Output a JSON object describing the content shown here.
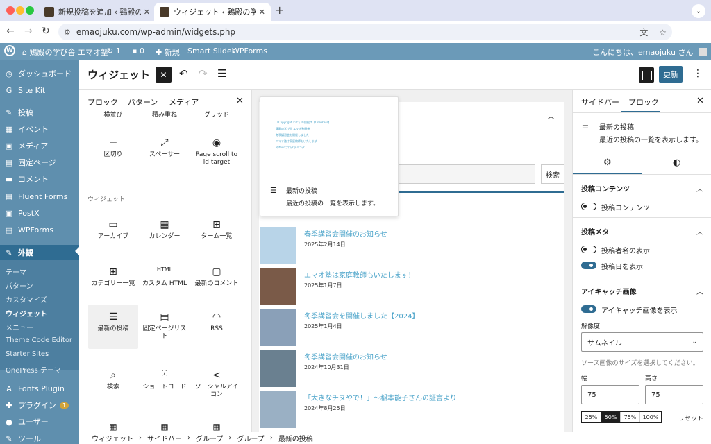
{
  "browser": {
    "tabs": [
      {
        "label": "新規投稿を追加 ‹ 鶏殿の学び舎 エ"
      },
      {
        "label": "ウィジェット ‹ 鶏殿の学び舎 エマ"
      }
    ],
    "url": "emaojuku.com/wp-admin/widgets.php"
  },
  "adminbar": {
    "site_name": "鶏殿の学び舎 エマオ塾",
    "updates_count": "1",
    "comments_count": "0",
    "new_label": "新規",
    "smart_slider": "Smart Slider",
    "wpforms": "WPForms",
    "greeting": "こんにちは、emaojuku さん"
  },
  "sidebar": {
    "items": [
      {
        "icon": "dashboard-icon",
        "glyph": "◷",
        "label": "ダッシュボード"
      },
      {
        "icon": "sitekit-icon",
        "glyph": "G",
        "label": "Site Kit"
      },
      {
        "icon": "pin-icon",
        "glyph": "✎",
        "label": "投稿"
      },
      {
        "icon": "calendar-icon",
        "glyph": "▦",
        "label": "イベント"
      },
      {
        "icon": "media-icon",
        "glyph": "▣",
        "label": "メディア"
      },
      {
        "icon": "page-icon",
        "glyph": "▤",
        "label": "固定ページ"
      },
      {
        "icon": "comment-icon",
        "glyph": "▬",
        "label": "コメント"
      },
      {
        "icon": "forms-icon",
        "glyph": "▤",
        "label": "Fluent Forms"
      },
      {
        "icon": "postx-icon",
        "glyph": "▣",
        "label": "PostX"
      },
      {
        "icon": "wpforms-icon",
        "glyph": "▤",
        "label": "WPForms"
      },
      {
        "icon": "appearance-icon",
        "glyph": "✎",
        "label": "外観"
      }
    ],
    "submenu": [
      "テーマ",
      "パターン",
      "カスタマイズ",
      "ウィジェット",
      "メニュー",
      "Theme Code Editor",
      "Starter Sites",
      "OnePress テーマ"
    ],
    "items_after": [
      {
        "icon": "fonts-icon",
        "glyph": "A",
        "label": "Fonts Plugin"
      },
      {
        "icon": "plugin-icon",
        "glyph": "✚",
        "label": "プラグイン",
        "badge": "1"
      },
      {
        "icon": "user-icon",
        "glyph": "●",
        "label": "ユーザー"
      },
      {
        "icon": "tools-icon",
        "glyph": "✎",
        "label": "ツール"
      }
    ]
  },
  "editor": {
    "title": "ウィジェット",
    "save_label": "更新"
  },
  "inserter": {
    "tabs": [
      "ブロック",
      "パターン",
      "メディア"
    ],
    "partial_labels": [
      "横並び",
      "積み重ね",
      "グリッド"
    ],
    "design_blocks": [
      {
        "icon": "separator-icon",
        "glyph": "⊢",
        "label": "区切り"
      },
      {
        "icon": "spacer-icon",
        "glyph": "⤢",
        "label": "スペーサー"
      },
      {
        "icon": "page-scroll-icon",
        "glyph": "◉",
        "label": "Page scroll to id target"
      }
    ],
    "widgets_label": "ウィジェット",
    "widget_blocks": [
      {
        "icon": "archive-icon",
        "glyph": "▭",
        "label": "アーカイブ"
      },
      {
        "icon": "calendar-icon",
        "glyph": "▦",
        "label": "カレンダー"
      },
      {
        "icon": "tag-cloud-icon",
        "glyph": "⊞",
        "label": "ターム一覧"
      },
      {
        "icon": "categories-icon",
        "glyph": "⊞",
        "label": "カテゴリー一覧"
      },
      {
        "icon": "html-icon",
        "glyph": "HTML",
        "label": "カスタム HTML"
      },
      {
        "icon": "comment-icon",
        "glyph": "▢",
        "label": "最新のコメント"
      },
      {
        "icon": "latest-posts-icon",
        "glyph": "☰",
        "label": "最新の投稿"
      },
      {
        "icon": "page-list-icon",
        "glyph": "▤",
        "label": "固定ページリスト"
      },
      {
        "icon": "rss-icon",
        "glyph": "◠",
        "label": "RSS"
      },
      {
        "icon": "search-icon",
        "glyph": "⌕",
        "label": "検索"
      },
      {
        "icon": "shortcode-icon",
        "glyph": "[/]",
        "label": "ショートコード"
      },
      {
        "icon": "share-icon",
        "glyph": "<",
        "label": "ソーシャルアイコン"
      }
    ]
  },
  "preview": {
    "lines": [
      "「Copyright ©エ」©鶏殿ス【OnePress】",
      "鶏殿の学び舎 エマオ塾開催",
      "冬季講習会を開催しました",
      "エマオ塾は家庭教師もいたします",
      "Pythonプログラミング"
    ],
    "title": "最新の投稿",
    "description": "最近の投稿の一覧を表示します。"
  },
  "canvas": {
    "search_button": "検索",
    "posts": [
      {
        "title": "春季講習会開催のお知らせ",
        "date": "2025年2月14日",
        "thumb_color": "#b8d4e8"
      },
      {
        "title": "エマオ塾は家庭教師もいたします！",
        "date": "2025年1月7日",
        "thumb_color": "#7a5a48"
      },
      {
        "title": "冬季講習会を開催しました【2024】",
        "date": "2025年1月4日",
        "thumb_color": "#8aa0b8"
      },
      {
        "title": "冬季講習会開催のお知らせ",
        "date": "2024年10月31日",
        "thumb_color": "#6a8090"
      },
      {
        "title": "「大きなチヌやで！」〜稲本能子さんの証言より",
        "date": "2024年8月25日",
        "thumb_color": "#9ab0c4"
      }
    ]
  },
  "settings": {
    "tabs": [
      "サイドバー",
      "ブロック"
    ],
    "block_name": "最新の投稿",
    "block_desc": "最近の投稿の一覧を表示します。",
    "post_content_head": "投稿コンテンツ",
    "post_content_toggle": "投稿コンテンツ",
    "post_meta_head": "投稿メタ",
    "author_toggle": "投稿者名の表示",
    "date_toggle": "投稿日を表示",
    "featured_head": "アイキャッチ画像",
    "featured_toggle": "アイキャッチ画像を表示",
    "resolution_label": "解像度",
    "resolution_value": "サムネイル",
    "resolution_help": "ソース画像のサイズを選択してください。",
    "width_label": "幅",
    "height_label": "高さ",
    "width_value": "75",
    "height_value": "75",
    "percentages": [
      "25%",
      "50%",
      "75%",
      "100%"
    ],
    "reset_label": "リセット"
  },
  "breadcrumb": [
    "ウィジェット",
    "サイドバー",
    "グループ",
    "グループ",
    "最新の投稿"
  ],
  "colors": {
    "admin_bar": "#6b9ab8",
    "sidebar": "#5f8fae",
    "accent": "#2f6c92",
    "link": "#4aa3c9"
  }
}
